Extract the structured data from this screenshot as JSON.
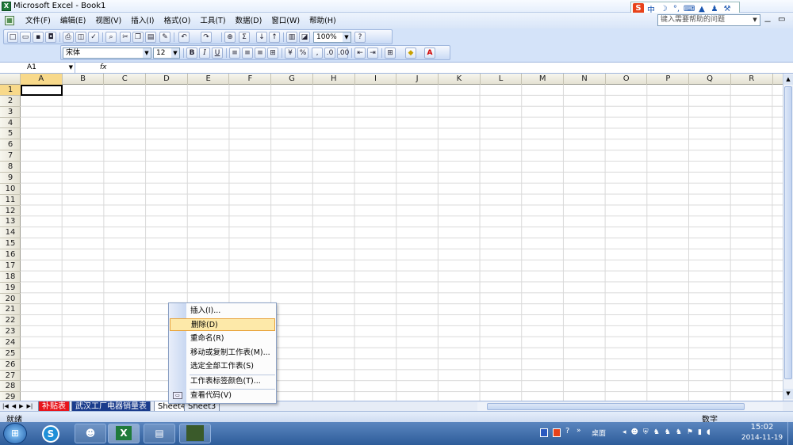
{
  "window": {
    "title": "Microsoft Excel - Book1",
    "app_icon": "X"
  },
  "menubar": {
    "items": [
      "文件(F)",
      "编辑(E)",
      "视图(V)",
      "插入(I)",
      "格式(O)",
      "工具(T)",
      "数据(D)",
      "窗口(W)",
      "帮助(H)"
    ],
    "help_placeholder": "键入需要帮助的问题",
    "window_controls": [
      "－",
      "▭",
      "×"
    ]
  },
  "ime": {
    "logo": "S",
    "mode": "中"
  },
  "toolbar": {
    "zoom": "100%",
    "font_name": "宋体",
    "font_size": "12",
    "bold_label": "B",
    "italic_label": "I",
    "underline_label": "U",
    "percent_label": "%",
    "comma_label": ","
  },
  "formula_bar": {
    "name_box": "A1",
    "fx": "fx"
  },
  "grid": {
    "columns": [
      "A",
      "B",
      "C",
      "D",
      "E",
      "F",
      "G",
      "H",
      "I",
      "J",
      "K",
      "L",
      "M",
      "N",
      "O",
      "P",
      "Q",
      "R"
    ],
    "rows": [
      "1",
      "2",
      "3",
      "4",
      "5",
      "6",
      "7",
      "8",
      "9",
      "10",
      "11",
      "12",
      "13",
      "14",
      "15",
      "16",
      "17",
      "18",
      "19",
      "20",
      "21",
      "22",
      "23",
      "24",
      "25",
      "26",
      "27",
      "28",
      "29"
    ],
    "selected_column": "A",
    "selected_row": "1"
  },
  "sheet_tabs": [
    {
      "label": "补贴表",
      "color": "#e8141c",
      "text_color": "#ffffff"
    },
    {
      "label": "武汉工厂电器销量表",
      "color": "#1a3c8c",
      "text_color": "#ffffff"
    },
    {
      "label": "Sheet4",
      "color": "#ffffff",
      "text_color": "#000000"
    },
    {
      "label": "Sheet3",
      "color": "#e6ecf6",
      "text_color": "#000000"
    }
  ],
  "context_menu": {
    "items": [
      {
        "label": "插入(I)...",
        "highlight": false
      },
      {
        "label": "删除(D)",
        "highlight": true
      },
      {
        "label": "重命名(R)",
        "highlight": false
      },
      {
        "label": "移动或复制工作表(M)...",
        "highlight": false
      },
      {
        "label": "选定全部工作表(S)",
        "highlight": false
      },
      {
        "label": "工作表标签颜色(T)...",
        "highlight": false
      },
      {
        "label": "查看代码(V)",
        "highlight": false
      }
    ]
  },
  "statusbar": {
    "ready": "就绪",
    "num": "数字"
  },
  "taskbar": {
    "desktop_label": "桌面",
    "time": "15:02",
    "date": "2014-11-19"
  }
}
